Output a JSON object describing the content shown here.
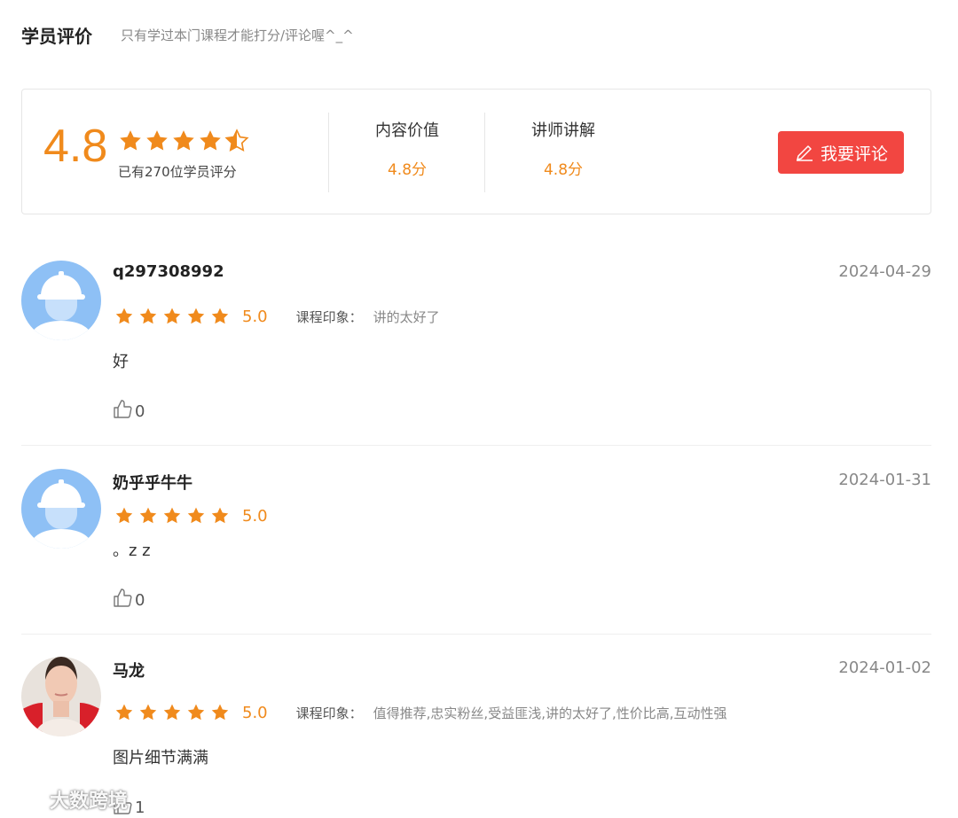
{
  "header": {
    "title": "学员评价",
    "note": "只有学过本门课程才能打分/评论喔^_^"
  },
  "summary": {
    "score": "4.8",
    "rated_count": "已有270位学员评分",
    "metrics": [
      {
        "label": "内容价值",
        "value": "4.8分"
      },
      {
        "label": "讲师讲解",
        "value": "4.8分"
      }
    ],
    "review_button": "我要评论"
  },
  "reviews": [
    {
      "username": "q297308992",
      "date": "2024-04-29",
      "score": "5.0",
      "impression_label": "课程印象：",
      "impression": "讲的太好了",
      "comment": "好",
      "likes": "0",
      "avatar": "helmet-avatar"
    },
    {
      "username": "奶乎乎牛牛",
      "date": "2024-01-31",
      "score": "5.0",
      "impression_label": "",
      "impression": "",
      "comment": "。z z",
      "likes": "0",
      "avatar": "helmet-avatar"
    },
    {
      "username": "马龙",
      "date": "2024-01-02",
      "score": "5.0",
      "impression_label": "课程印象：",
      "impression": "值得推荐,忠实粉丝,受益匪浅,讲的太好了,性价比高,互动性强",
      "comment": "图片细节满满",
      "likes": "1",
      "avatar": "photo-avatar"
    }
  ],
  "watermark": "大数跨境",
  "colors": {
    "accent": "#f08a1c",
    "button": "#f24641"
  }
}
